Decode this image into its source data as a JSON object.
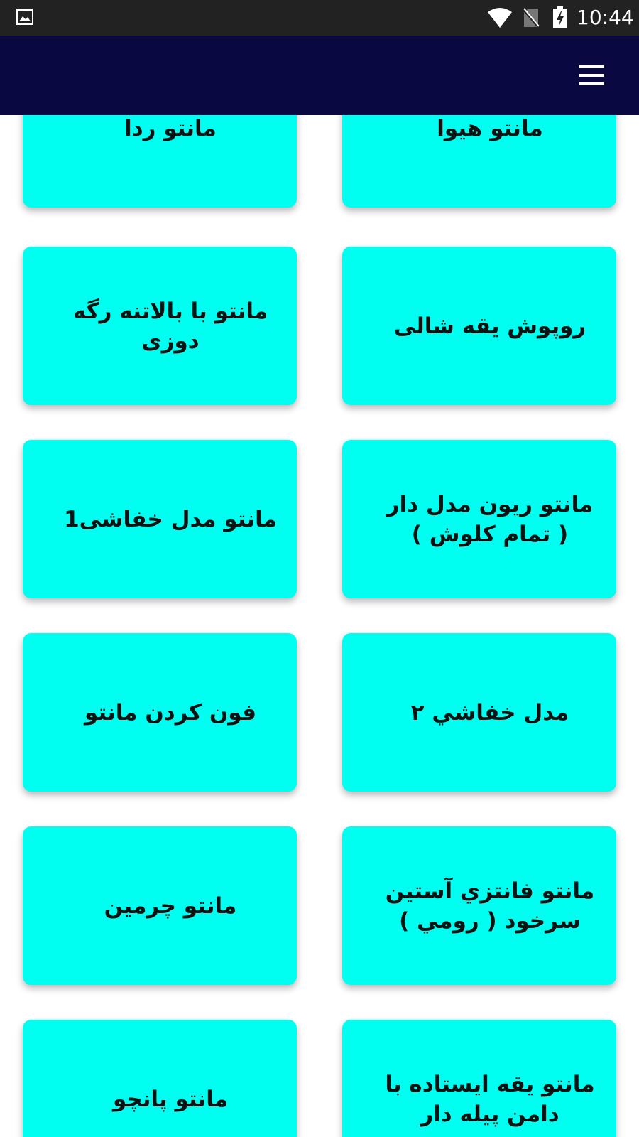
{
  "status_bar": {
    "time": "10:44",
    "icons": [
      "image-icon",
      "wifi-icon",
      "no-sim-icon",
      "battery-charging-icon"
    ]
  },
  "app_bar": {
    "background": "#0a0840",
    "menu_icon": "hamburger-menu-icon"
  },
  "card_color": "#00fff0",
  "items": [
    {
      "label": "مانتو ردا"
    },
    {
      "label": "مانتو هيوا"
    },
    {
      "label": "مانتو با بالاتنه رگه دوزی"
    },
    {
      "label": "روپوش يقه شالی"
    },
    {
      "label": "مانتو مدل خفاشی1"
    },
    {
      "label": "مانتو ريون مدل دار ( تمام كلوش )"
    },
    {
      "label": "فون کردن مانتو"
    },
    {
      "label": "مدل خفاشي ٢"
    },
    {
      "label": "مانتو چرمين"
    },
    {
      "label": "مانتو فانتزي آستين سرخود ( رومي )"
    },
    {
      "label": "مانتو پانچو"
    },
    {
      "label": "مانتو يقه ايستاده با دامن پيله دار"
    }
  ]
}
